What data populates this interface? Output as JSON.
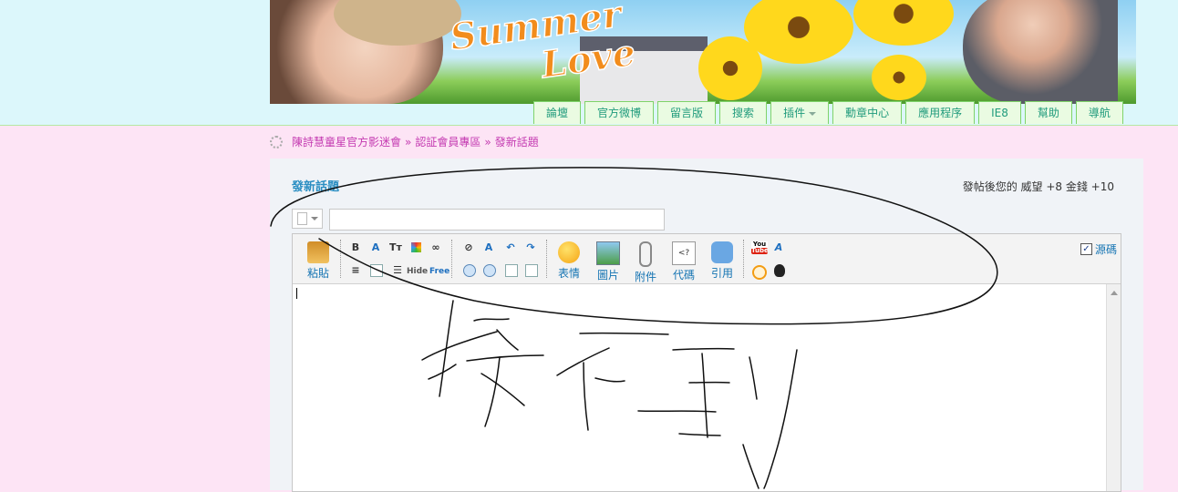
{
  "banner": {
    "title_line1": "Summer",
    "title_line2": "Love"
  },
  "nav": {
    "items": [
      {
        "label": "論壇"
      },
      {
        "label": "官方微博"
      },
      {
        "label": "留言版"
      },
      {
        "label": "搜索"
      },
      {
        "label": "插件",
        "has_dropdown": true
      },
      {
        "label": "勳章中心"
      },
      {
        "label": "應用程序"
      },
      {
        "label": "IE8"
      },
      {
        "label": "幫助"
      },
      {
        "label": "導航"
      }
    ]
  },
  "breadcrumb": {
    "items": [
      "陳詩慧童星官方影迷會",
      "認証會員專區",
      "發新話題"
    ],
    "separator": "»"
  },
  "post": {
    "title": "發新話題",
    "reward_text": "發帖後您的 威望 +8  金錢 +10",
    "subject_value": "",
    "subject_placeholder": ""
  },
  "toolbar": {
    "paste": "粘貼",
    "emoticon": "表情",
    "image": "圖片",
    "attach": "附件",
    "code": "代碼",
    "quote": "引用",
    "source": "源碼",
    "source_checked": true,
    "hide_label": "Hide",
    "free_label": "Free",
    "bold": "B",
    "font_size": "Tт",
    "youtube_top": "You",
    "youtube_bottom": "Tube",
    "code_glyph": "<?"
  },
  "colors": {
    "nav_text": "#209b7c",
    "breadcrumb_text": "#c43ab1",
    "title_blue": "#2a8ec2",
    "toolbar_label": "#1574b3"
  }
}
